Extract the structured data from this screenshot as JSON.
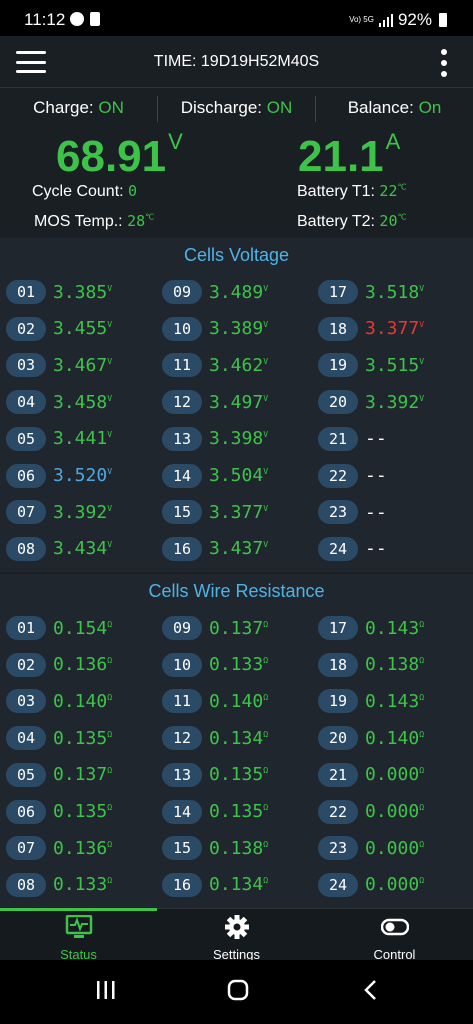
{
  "statusbar": {
    "time": "11:12",
    "signal_label": "Vo) 5G",
    "battery": "92%"
  },
  "appbar": {
    "title": "TIME: 19D19H52M40S"
  },
  "toggles": [
    {
      "label": "Charge: ",
      "value": "ON"
    },
    {
      "label": "Discharge: ",
      "value": "ON"
    },
    {
      "label": "Balance: ",
      "value": "On"
    }
  ],
  "summary": {
    "voltage": "68.91",
    "voltage_unit": "V",
    "current": "21.1",
    "current_unit": "A",
    "cycle_count_label": "Cycle Count:",
    "cycle_count": "0",
    "mos_temp_label": "MOS Temp.:",
    "mos_temp": "28",
    "temp_unit": "℃",
    "batt_t1_label": "Battery T1:",
    "batt_t1": "22",
    "batt_t2_label": "Battery T2:",
    "batt_t2": "20"
  },
  "cells_voltage": {
    "title": "Cells Voltage",
    "unit": "V",
    "cells": [
      {
        "id": "01",
        "value": "3.385",
        "color": "green"
      },
      {
        "id": "02",
        "value": "3.455",
        "color": "green"
      },
      {
        "id": "03",
        "value": "3.467",
        "color": "green"
      },
      {
        "id": "04",
        "value": "3.458",
        "color": "green"
      },
      {
        "id": "05",
        "value": "3.441",
        "color": "green"
      },
      {
        "id": "06",
        "value": "3.520",
        "color": "blue"
      },
      {
        "id": "07",
        "value": "3.392",
        "color": "green"
      },
      {
        "id": "08",
        "value": "3.434",
        "color": "green"
      },
      {
        "id": "09",
        "value": "3.489",
        "color": "green"
      },
      {
        "id": "10",
        "value": "3.389",
        "color": "green"
      },
      {
        "id": "11",
        "value": "3.462",
        "color": "green"
      },
      {
        "id": "12",
        "value": "3.497",
        "color": "green"
      },
      {
        "id": "13",
        "value": "3.398",
        "color": "green"
      },
      {
        "id": "14",
        "value": "3.504",
        "color": "green"
      },
      {
        "id": "15",
        "value": "3.377",
        "color": "green"
      },
      {
        "id": "16",
        "value": "3.437",
        "color": "green"
      },
      {
        "id": "17",
        "value": "3.518",
        "color": "green"
      },
      {
        "id": "18",
        "value": "3.377",
        "color": "red"
      },
      {
        "id": "19",
        "value": "3.515",
        "color": "green"
      },
      {
        "id": "20",
        "value": "3.392",
        "color": "green"
      },
      {
        "id": "21",
        "value": "--",
        "color": "dash"
      },
      {
        "id": "22",
        "value": "--",
        "color": "dash"
      },
      {
        "id": "23",
        "value": "--",
        "color": "dash"
      },
      {
        "id": "24",
        "value": "--",
        "color": "dash"
      }
    ]
  },
  "cells_resistance": {
    "title": "Cells Wire Resistance",
    "unit": "Ω",
    "cells": [
      {
        "id": "01",
        "value": "0.154"
      },
      {
        "id": "02",
        "value": "0.136"
      },
      {
        "id": "03",
        "value": "0.140"
      },
      {
        "id": "04",
        "value": "0.135"
      },
      {
        "id": "05",
        "value": "0.137"
      },
      {
        "id": "06",
        "value": "0.135"
      },
      {
        "id": "07",
        "value": "0.136"
      },
      {
        "id": "08",
        "value": "0.133"
      },
      {
        "id": "09",
        "value": "0.137"
      },
      {
        "id": "10",
        "value": "0.133"
      },
      {
        "id": "11",
        "value": "0.140"
      },
      {
        "id": "12",
        "value": "0.134"
      },
      {
        "id": "13",
        "value": "0.135"
      },
      {
        "id": "14",
        "value": "0.135"
      },
      {
        "id": "15",
        "value": "0.138"
      },
      {
        "id": "16",
        "value": "0.134"
      },
      {
        "id": "17",
        "value": "0.143"
      },
      {
        "id": "18",
        "value": "0.138"
      },
      {
        "id": "19",
        "value": "0.143"
      },
      {
        "id": "20",
        "value": "0.140"
      },
      {
        "id": "21",
        "value": "0.000"
      },
      {
        "id": "22",
        "value": "0.000"
      },
      {
        "id": "23",
        "value": "0.000"
      },
      {
        "id": "24",
        "value": "0.000"
      }
    ]
  },
  "bottomnav": [
    {
      "label": "Status",
      "icon": "monitor-pulse-icon",
      "active": true
    },
    {
      "label": "Settings",
      "icon": "gear-icon",
      "active": false
    },
    {
      "label": "Control",
      "icon": "toggle-icon",
      "active": false
    }
  ],
  "colors": {
    "green": "#3ec34a",
    "blue": "#4fa7e0",
    "red": "#e53935",
    "accent_title": "#4fb3e8"
  }
}
